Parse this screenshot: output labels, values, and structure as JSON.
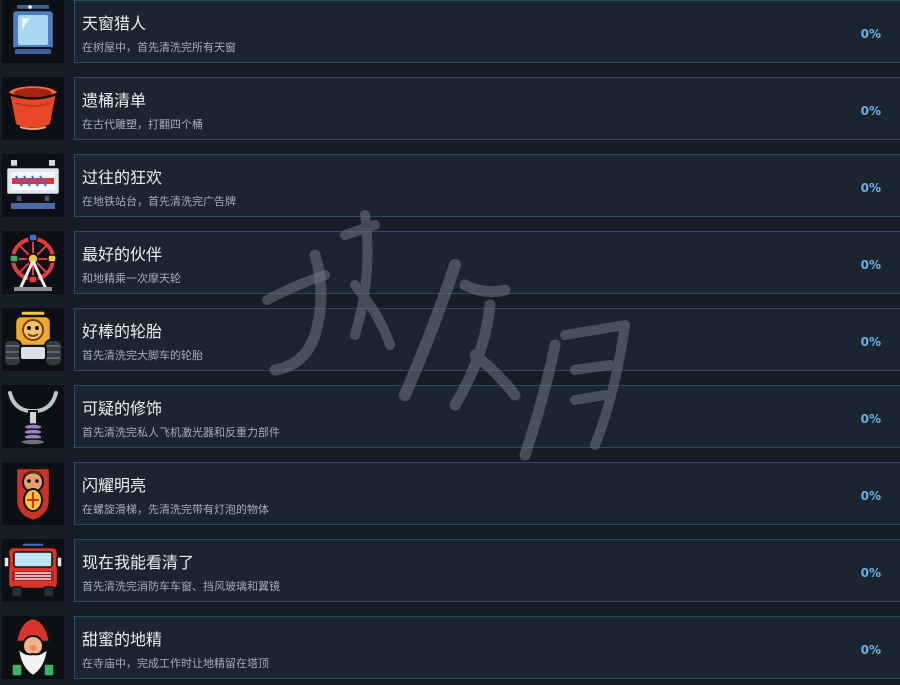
{
  "achievements": [
    {
      "icon": "skylight-lantern-icon",
      "title": "天窗猎人",
      "desc": "在树屋中，首先清洗完所有天窗",
      "progress": "0%"
    },
    {
      "icon": "red-bucket-icon",
      "title": "遗桶清单",
      "desc": "在古代雕塑，打翻四个桶",
      "progress": "0%"
    },
    {
      "icon": "billboard-icon",
      "title": "过往的狂欢",
      "desc": "在地铁站台，首先清洗完广告牌",
      "progress": "0%"
    },
    {
      "icon": "ferris-wheel-icon",
      "title": "最好的伙伴",
      "desc": "和地精乘一次摩天轮",
      "progress": "0%"
    },
    {
      "icon": "monster-truck-icon",
      "title": "好棒的轮胎",
      "desc": "首先清洗完大脚车的轮胎",
      "progress": "0%"
    },
    {
      "icon": "antigravity-part-icon",
      "title": "可疑的修饰",
      "desc": "首先清洗完私人飞机激光器和反重力部件",
      "progress": "0%"
    },
    {
      "icon": "bright-shield-icon",
      "title": "闪耀明亮",
      "desc": "在螺旋滑梯，先清洗完带有灯泡的物体",
      "progress": "0%"
    },
    {
      "icon": "fire-truck-icon",
      "title": "现在我能看清了",
      "desc": "首先清洗完消防车车窗、挡风玻璃和翼镜",
      "progress": "0%"
    },
    {
      "icon": "gnome-icon",
      "title": "甜蜜的地精",
      "desc": "在寺庙中，完成工作时让地精留在塔顶",
      "progress": "0%"
    }
  ],
  "watermark": "游侠网",
  "colors": {
    "background": "#161d26",
    "panel": "#1b2530",
    "panel_border": "#2a4a5f",
    "title": "#e9eef3",
    "description": "#a4adb6",
    "progress": "#6ab1e4"
  }
}
